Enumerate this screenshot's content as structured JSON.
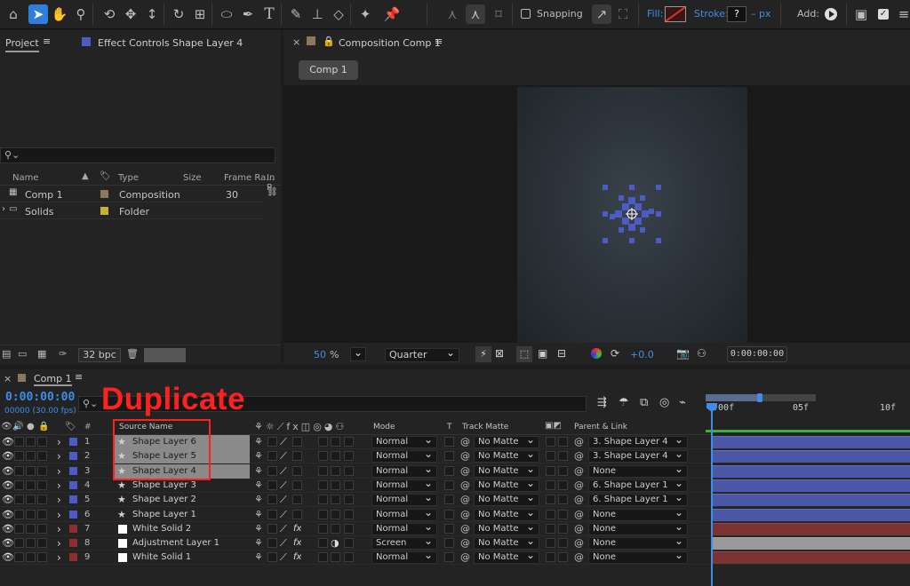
{
  "colors": {
    "accent": "#2e7fdc",
    "blue_label": "#4d5cc4",
    "red_label": "#8e2f2f",
    "tan_label": "#8c7860",
    "yellow_label": "#c6b22d",
    "annotation": "#ff2020",
    "shape_bar": "#4b58a8",
    "solid_bar": "#7a3232",
    "white_solid": "#ffffff"
  },
  "toolbar": {
    "icons": [
      "home-icon",
      "selection-tool-icon",
      "hand-tool-icon",
      "zoom-tool-icon",
      "orbit-camera-icon",
      "pan-camera-icon",
      "dolly-camera-icon",
      "rotate-tool-icon",
      "pan-behind-icon",
      "ellipse-tool-icon",
      "pen-tool-icon",
      "type-tool-icon",
      "brush-tool-icon",
      "clone-stamp-icon",
      "eraser-icon",
      "roto-brush-icon",
      "puppet-pin-icon"
    ],
    "snapping_label": "Snapping",
    "fill_label": "Fill:",
    "stroke_label": "Stroke:",
    "stroke_value": "?",
    "stroke_unit": "– px",
    "add_label": "Add:"
  },
  "project_panel": {
    "tab_project": "Project",
    "tab_effect_controls": "Effect Controls Shape Layer 4",
    "search_placeholder": "",
    "columns": {
      "name": "Name",
      "type": "Type",
      "size": "Size",
      "frame_rate": "Frame Ra...",
      "in_point": "In P"
    },
    "items": [
      {
        "name": "Comp 1",
        "type": "Composition",
        "size": "",
        "frame_rate": "30",
        "icon": "composition-icon"
      },
      {
        "name": "Solids",
        "type": "Folder",
        "size": "",
        "frame_rate": "",
        "icon": "folder-icon"
      }
    ],
    "bpc": "32 bpc"
  },
  "comp_panel": {
    "tab_title": "Composition Comp 1",
    "sub_tab": "Comp 1",
    "zoom": "50",
    "zoom_unit": "%",
    "resolution": "Quarter",
    "exposure": "+0.0",
    "timecode": "0:00:00:00"
  },
  "timeline": {
    "tab_title": "Comp 1",
    "timecode": "0:00:00:00",
    "fps_info": "00000 (30.00 fps)",
    "annotation": "Duplicate",
    "columns": {
      "num": "#",
      "source_name": "Source Name",
      "mode": "Mode",
      "t": "T",
      "track_matte": "Track Matte",
      "parent": "Parent & Link"
    },
    "ruler": {
      "start": "0:00f",
      "mid": "05f",
      "end": "10f"
    },
    "layers": [
      {
        "num": "1",
        "name": "Shape Layer 6",
        "icon": "shape",
        "mode": "Normal",
        "matte": "No Matte",
        "parent": "3. Shape Layer 4",
        "selected": true,
        "bar": "shape"
      },
      {
        "num": "2",
        "name": "Shape Layer 5",
        "icon": "shape",
        "mode": "Normal",
        "matte": "No Matte",
        "parent": "3. Shape Layer 4",
        "selected": true,
        "bar": "shape"
      },
      {
        "num": "3",
        "name": "Shape Layer 4",
        "icon": "shape",
        "mode": "Normal",
        "matte": "No Matte",
        "parent": "None",
        "selected": true,
        "bar": "shape"
      },
      {
        "num": "4",
        "name": "Shape Layer 3",
        "icon": "shape",
        "mode": "Normal",
        "matte": "No Matte",
        "parent": "6. Shape Layer 1",
        "selected": false,
        "bar": "shape"
      },
      {
        "num": "5",
        "name": "Shape Layer 2",
        "icon": "shape",
        "mode": "Normal",
        "matte": "No Matte",
        "parent": "6. Shape Layer 1",
        "selected": false,
        "bar": "shape"
      },
      {
        "num": "6",
        "name": "Shape Layer 1",
        "icon": "shape",
        "mode": "Normal",
        "matte": "No Matte",
        "parent": "None",
        "selected": false,
        "bar": "shape"
      },
      {
        "num": "7",
        "name": "White Solid 2",
        "icon": "solid",
        "mode": "Normal",
        "matte": "No Matte",
        "parent": "None",
        "selected": false,
        "bar": "solid"
      },
      {
        "num": "8",
        "name": "Adjustment Layer 1",
        "icon": "solid",
        "mode": "Screen",
        "matte": "No Matte",
        "parent": "None",
        "selected": false,
        "bar": "adjust"
      },
      {
        "num": "9",
        "name": "White Solid 1",
        "icon": "solid",
        "mode": "Normal",
        "matte": "No Matte",
        "parent": "None",
        "selected": false,
        "bar": "solid"
      }
    ]
  }
}
